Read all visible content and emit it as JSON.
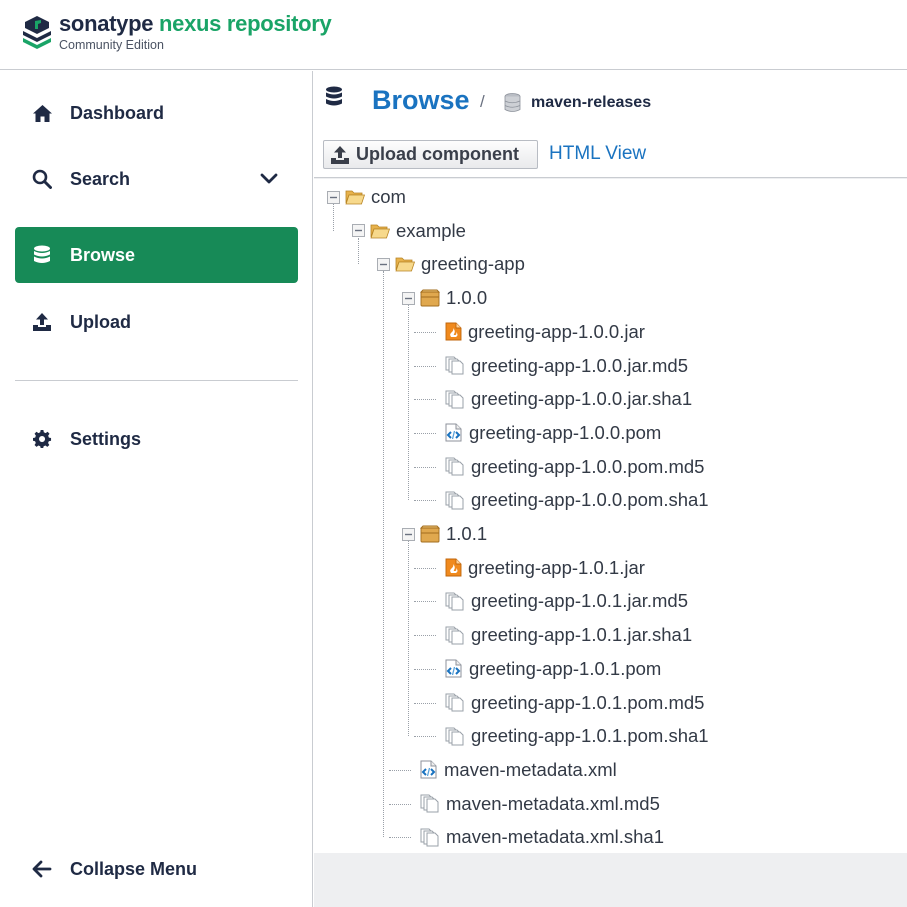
{
  "header": {
    "brand_primary": "sonatype",
    "brand_secondary": "nexus repository",
    "edition": "Community Edition",
    "brand_color": "#1aa467"
  },
  "sidebar": {
    "items": [
      {
        "label": "Dashboard",
        "icon": "home-icon"
      },
      {
        "label": "Search",
        "icon": "search-icon",
        "expandable": true
      },
      {
        "label": "Browse",
        "icon": "database-icon",
        "active": true
      },
      {
        "label": "Upload",
        "icon": "upload-icon"
      },
      {
        "label": "Settings",
        "icon": "gear-icon"
      }
    ],
    "collapse_label": "Collapse Menu",
    "active_color": "#178a57"
  },
  "main": {
    "title": "Browse",
    "breadcrumb_sep": "/",
    "repository": "maven-releases",
    "upload_label": "Upload component",
    "html_view_label": "HTML View",
    "accent_color": "#1a73c0"
  },
  "tree": [
    {
      "label": "com",
      "type": "folder",
      "level": 0
    },
    {
      "label": "example",
      "type": "folder",
      "level": 1
    },
    {
      "label": "greeting-app",
      "type": "folder",
      "level": 2
    },
    {
      "label": "1.0.0",
      "type": "component",
      "level": 3
    },
    {
      "label": "greeting-app-1.0.0.jar",
      "type": "jar",
      "level": 4
    },
    {
      "label": "greeting-app-1.0.0.jar.md5",
      "type": "file",
      "level": 4
    },
    {
      "label": "greeting-app-1.0.0.jar.sha1",
      "type": "file",
      "level": 4
    },
    {
      "label": "greeting-app-1.0.0.pom",
      "type": "xml",
      "level": 4
    },
    {
      "label": "greeting-app-1.0.0.pom.md5",
      "type": "file",
      "level": 4
    },
    {
      "label": "greeting-app-1.0.0.pom.sha1",
      "type": "file",
      "level": 4
    },
    {
      "label": "1.0.1",
      "type": "component",
      "level": 3
    },
    {
      "label": "greeting-app-1.0.1.jar",
      "type": "jar",
      "level": 4
    },
    {
      "label": "greeting-app-1.0.1.jar.md5",
      "type": "file",
      "level": 4
    },
    {
      "label": "greeting-app-1.0.1.jar.sha1",
      "type": "file",
      "level": 4
    },
    {
      "label": "greeting-app-1.0.1.pom",
      "type": "xml",
      "level": 4
    },
    {
      "label": "greeting-app-1.0.1.pom.md5",
      "type": "file",
      "level": 4
    },
    {
      "label": "greeting-app-1.0.1.pom.sha1",
      "type": "file",
      "level": 4
    },
    {
      "label": "maven-metadata.xml",
      "type": "xml",
      "level": 3
    },
    {
      "label": "maven-metadata.xml.md5",
      "type": "file",
      "level": 3
    },
    {
      "label": "maven-metadata.xml.sha1",
      "type": "file",
      "level": 3
    }
  ]
}
